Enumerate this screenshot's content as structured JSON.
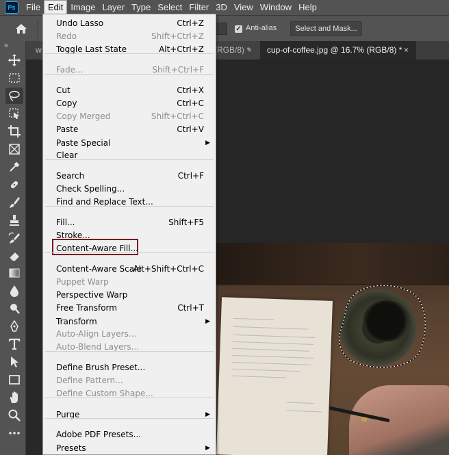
{
  "app": {
    "logo": "Ps"
  },
  "menubar": {
    "items": [
      {
        "label": "File"
      },
      {
        "label": "Edit",
        "active": true
      },
      {
        "label": "Image"
      },
      {
        "label": "Layer"
      },
      {
        "label": "Type"
      },
      {
        "label": "Select"
      },
      {
        "label": "Filter"
      },
      {
        "label": "3D"
      },
      {
        "label": "View"
      },
      {
        "label": "Window"
      },
      {
        "label": "Help"
      }
    ]
  },
  "options": {
    "anti_alias_label": "Anti-alias",
    "anti_alias_checked": true,
    "select_and_mask_label": "Select and Mask..."
  },
  "tabs": {
    "first_prefix": "w",
    "first_suffix": "(RGB/8) *",
    "first_close": "×",
    "active_title": "cup-of-coffee.jpg @ 16.7% (RGB/8) *",
    "active_close": "×"
  },
  "toolbar": {
    "collapse": "»",
    "tools": [
      {
        "name": "move-tool-icon"
      },
      {
        "name": "marquee-tool-icon"
      },
      {
        "name": "lasso-tool-icon",
        "selected": true
      },
      {
        "name": "object-selection-tool-icon"
      },
      {
        "name": "crop-tool-icon"
      },
      {
        "name": "frame-tool-icon"
      },
      {
        "name": "eyedropper-tool-icon"
      },
      {
        "name": "healing-brush-tool-icon"
      },
      {
        "name": "brush-tool-icon"
      },
      {
        "name": "clone-stamp-tool-icon"
      },
      {
        "name": "history-brush-tool-icon"
      },
      {
        "name": "eraser-tool-icon"
      },
      {
        "name": "gradient-tool-icon"
      },
      {
        "name": "blur-tool-icon"
      },
      {
        "name": "dodge-tool-icon"
      },
      {
        "name": "pen-tool-icon"
      },
      {
        "name": "type-tool-icon"
      },
      {
        "name": "path-selection-tool-icon"
      },
      {
        "name": "rectangle-tool-icon"
      },
      {
        "name": "hand-tool-icon"
      },
      {
        "name": "zoom-tool-icon"
      },
      {
        "name": "more-tools-icon"
      }
    ]
  },
  "edit_menu": {
    "items": [
      {
        "label": "Undo Lasso",
        "shortcut": "Ctrl+Z"
      },
      {
        "label": "Redo",
        "shortcut": "Shift+Ctrl+Z",
        "disabled": true
      },
      {
        "label": "Toggle Last State",
        "shortcut": "Alt+Ctrl+Z"
      },
      {
        "separator": true
      },
      {
        "label": "Fade...",
        "shortcut": "Shift+Ctrl+F",
        "disabled": true
      },
      {
        "separator": true
      },
      {
        "label": "Cut",
        "shortcut": "Ctrl+X"
      },
      {
        "label": "Copy",
        "shortcut": "Ctrl+C"
      },
      {
        "label": "Copy Merged",
        "shortcut": "Shift+Ctrl+C",
        "disabled": true
      },
      {
        "label": "Paste",
        "shortcut": "Ctrl+V"
      },
      {
        "label": "Paste Special",
        "submenu": true
      },
      {
        "label": "Clear"
      },
      {
        "separator": true
      },
      {
        "label": "Search",
        "shortcut": "Ctrl+F"
      },
      {
        "label": "Check Spelling..."
      },
      {
        "label": "Find and Replace Text..."
      },
      {
        "separator": true
      },
      {
        "label": "Fill...",
        "shortcut": "Shift+F5"
      },
      {
        "label": "Stroke..."
      },
      {
        "label": "Content-Aware Fill...",
        "highlighted": true
      },
      {
        "separator": true
      },
      {
        "label": "Content-Aware Scale",
        "shortcut": "Alt+Shift+Ctrl+C"
      },
      {
        "label": "Puppet Warp",
        "disabled": true
      },
      {
        "label": "Perspective Warp"
      },
      {
        "label": "Free Transform",
        "shortcut": "Ctrl+T"
      },
      {
        "label": "Transform",
        "submenu": true
      },
      {
        "label": "Auto-Align Layers...",
        "disabled": true
      },
      {
        "label": "Auto-Blend Layers...",
        "disabled": true
      },
      {
        "separator": true
      },
      {
        "label": "Define Brush Preset..."
      },
      {
        "label": "Define Pattern...",
        "disabled": true
      },
      {
        "label": "Define Custom Shape...",
        "disabled": true
      },
      {
        "separator": true
      },
      {
        "label": "Purge",
        "submenu": true
      },
      {
        "separator": true
      },
      {
        "label": "Adobe PDF Presets..."
      },
      {
        "label": "Presets",
        "submenu": true
      }
    ]
  },
  "colors": {
    "ui_panel": "#535353",
    "canvas_bg": "#282828",
    "menu_bg": "#f0f0f0",
    "highlight_box": "#7a1424",
    "disabled_text": "#8d8d8d"
  }
}
